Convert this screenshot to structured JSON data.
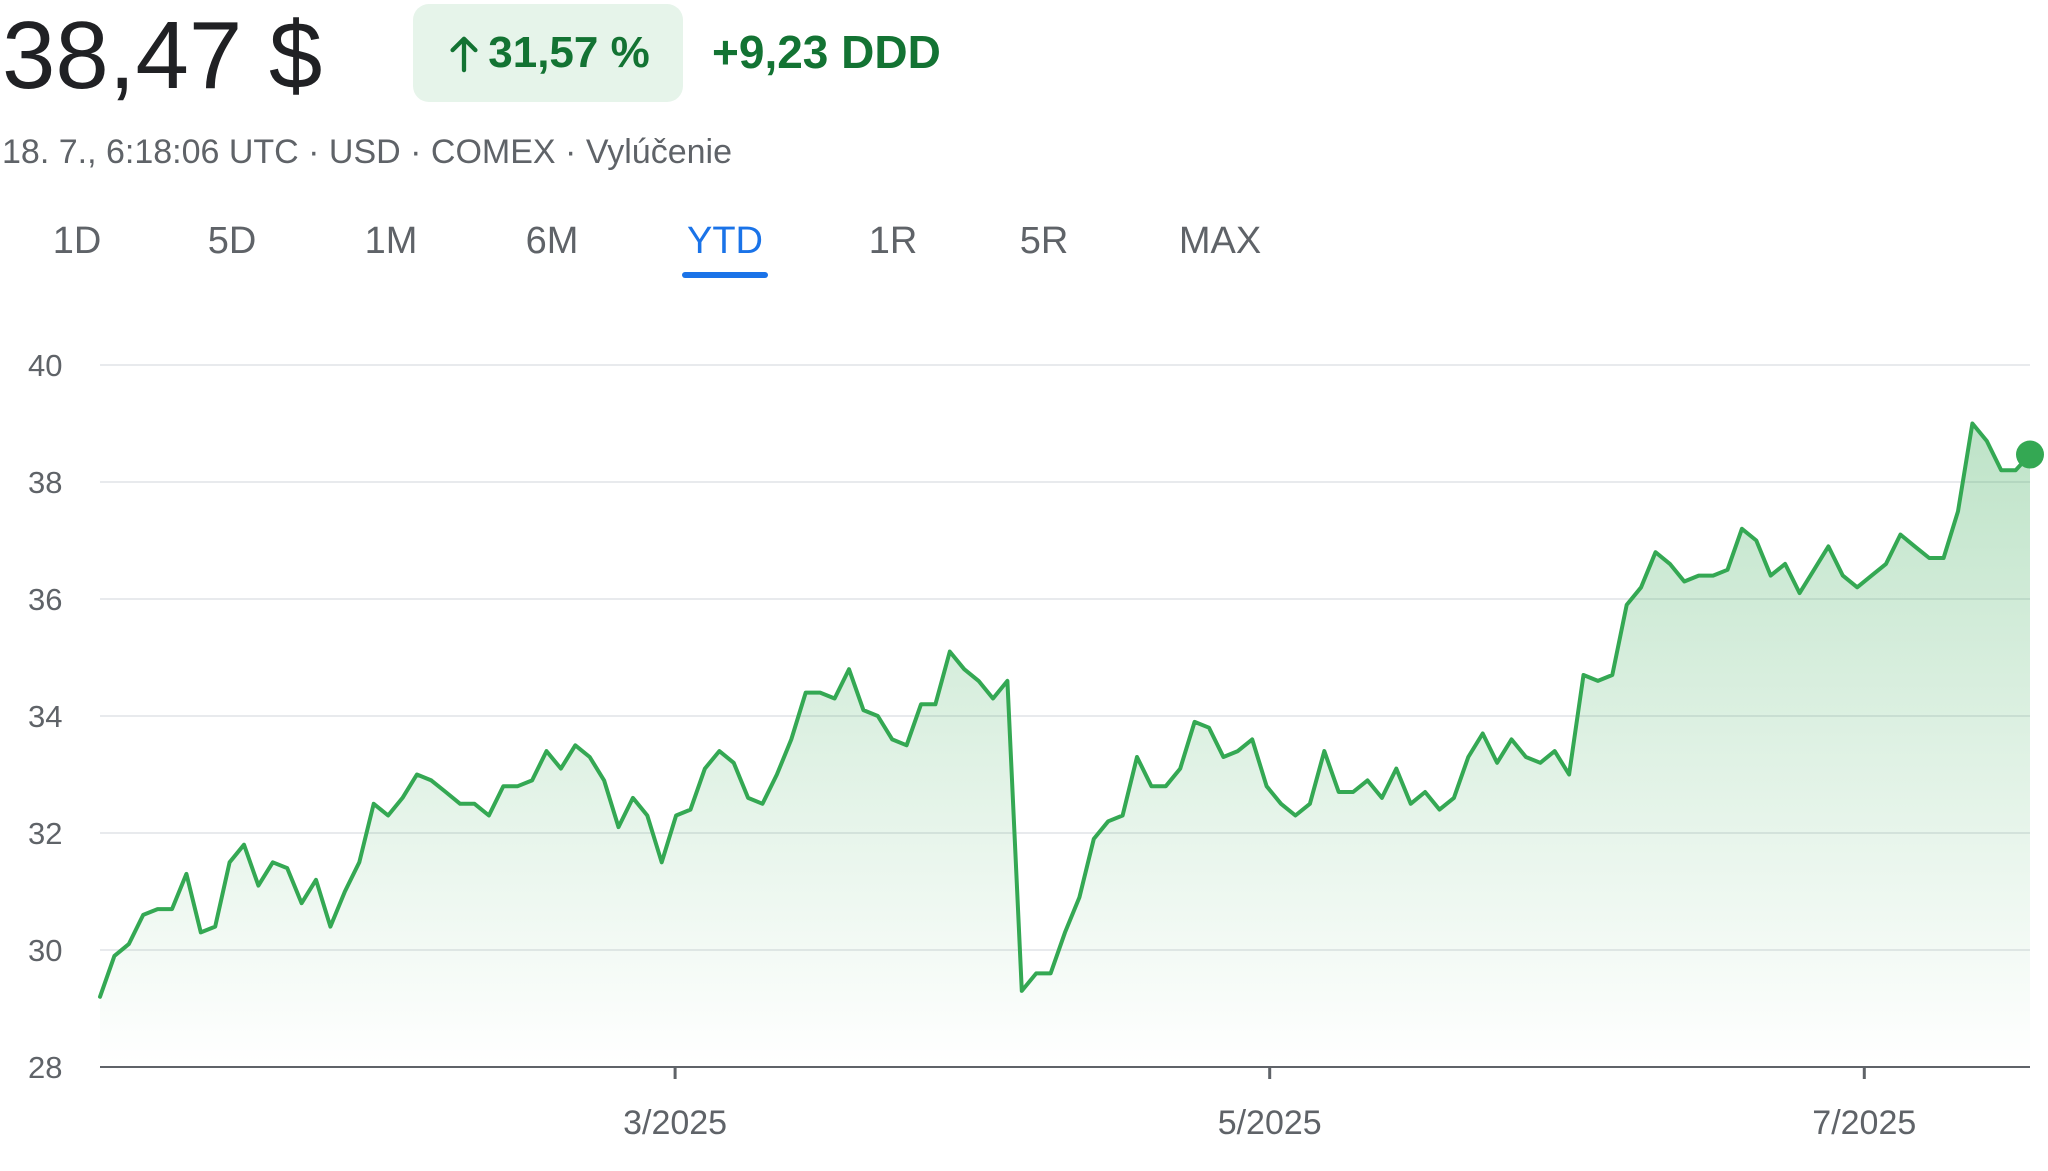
{
  "header": {
    "price": "38,47 $",
    "change_percent": "31,57 %",
    "change_abs": "+9,23 DDD",
    "meta": "18. 7., 6:18:06 UTC · USD · COMEX · Vylúčenie"
  },
  "tabs": [
    {
      "label": "1D"
    },
    {
      "label": "5D"
    },
    {
      "label": "1M"
    },
    {
      "label": "6M"
    },
    {
      "label": "YTD",
      "active": true
    },
    {
      "label": "1R"
    },
    {
      "label": "5R"
    },
    {
      "label": "MAX"
    }
  ],
  "colors": {
    "line": "#34a853",
    "positive": "#137333",
    "badge_bg": "#e6f4ea",
    "accent": "#1a73e8",
    "grid": "#e8eaed"
  },
  "icons": {
    "trend": "arrow-up-icon"
  },
  "chart_data": {
    "type": "area",
    "ylim": [
      28,
      40
    ],
    "yticks": [
      "28",
      "30",
      "32",
      "34",
      "36",
      "38",
      "40"
    ],
    "xlim": [
      "2025-01-01",
      "2025-07-18"
    ],
    "xticks": [
      {
        "label": "3/2025",
        "date": "2025-03-01"
      },
      {
        "label": "5/2025",
        "date": "2025-05-01"
      },
      {
        "label": "7/2025",
        "date": "2025-07-01"
      }
    ],
    "x": [
      "2025-01-01",
      "2025-01-03",
      "2025-01-04",
      "2025-01-06",
      "2025-01-07",
      "2025-01-09",
      "2025-01-10",
      "2025-01-12",
      "2025-01-13",
      "2025-01-15",
      "2025-01-16",
      "2025-01-18",
      "2025-01-20",
      "2025-01-21",
      "2025-01-23",
      "2025-01-25",
      "2025-01-26",
      "2025-01-28",
      "2025-01-30",
      "2025-02-01",
      "2025-02-02",
      "2025-02-04",
      "2025-02-06",
      "2025-02-08",
      "2025-02-09",
      "2025-02-11",
      "2025-02-13",
      "2025-02-15",
      "2025-02-16",
      "2025-02-18",
      "2025-02-20",
      "2025-02-22",
      "2025-02-23",
      "2025-02-25",
      "2025-02-27",
      "2025-03-01",
      "2025-03-02",
      "2025-03-04",
      "2025-03-06",
      "2025-03-08",
      "2025-03-09",
      "2025-03-11",
      "2025-03-13",
      "2025-03-15",
      "2025-03-16",
      "2025-03-18",
      "2025-03-20",
      "2025-03-22",
      "2025-03-23",
      "2025-03-25",
      "2025-03-27",
      "2025-03-29",
      "2025-03-30",
      "2025-04-01",
      "2025-04-03",
      "2025-04-05",
      "2025-04-06",
      "2025-04-08",
      "2025-04-09",
      "2025-04-11",
      "2025-04-13",
      "2025-04-15",
      "2025-04-16",
      "2025-04-18",
      "2025-04-20",
      "2025-04-22",
      "2025-04-23",
      "2025-04-25",
      "2025-04-27",
      "2025-04-29",
      "2025-05-01",
      "2025-05-03",
      "2025-05-05",
      "2025-05-06",
      "2025-05-08",
      "2025-05-10",
      "2025-05-12",
      "2025-05-13",
      "2025-05-15",
      "2025-05-17",
      "2025-05-19",
      "2025-05-20",
      "2025-05-22",
      "2025-05-24",
      "2025-05-26",
      "2025-05-27",
      "2025-05-29",
      "2025-05-31",
      "2025-06-02",
      "2025-06-03",
      "2025-06-05",
      "2025-06-07",
      "2025-06-09",
      "2025-06-10",
      "2025-06-12",
      "2025-06-14",
      "2025-06-16",
      "2025-06-17",
      "2025-06-19",
      "2025-06-21",
      "2025-06-23",
      "2025-06-24",
      "2025-06-26",
      "2025-06-28",
      "2025-06-30",
      "2025-07-01",
      "2025-07-03",
      "2025-07-05",
      "2025-07-07",
      "2025-07-08",
      "2025-07-10",
      "2025-07-12",
      "2025-07-14",
      "2025-07-16",
      "2025-07-18"
    ],
    "series": [
      {
        "values": [
          29.2,
          29.9,
          30.1,
          30.6,
          30.7,
          30.7,
          31.3,
          30.3,
          30.4,
          31.5,
          31.8,
          31.1,
          31.5,
          31.4,
          30.8,
          31.2,
          30.4,
          31.0,
          31.5,
          32.5,
          32.3,
          32.6,
          33.0,
          32.9,
          32.7,
          32.5,
          32.5,
          32.3,
          32.8,
          32.8,
          32.9,
          33.4,
          33.1,
          33.5,
          33.3,
          32.9,
          32.1,
          32.6,
          32.3,
          31.5,
          32.3,
          32.4,
          33.1,
          33.4,
          33.2,
          32.6,
          32.5,
          33.0,
          33.6,
          34.4,
          34.4,
          34.3,
          34.8,
          34.1,
          34.0,
          33.6,
          33.5,
          34.2,
          34.2,
          35.1,
          34.8,
          34.6,
          34.3,
          34.6,
          29.3,
          29.6,
          29.6,
          30.3,
          30.9,
          31.9,
          32.2,
          32.3,
          33.3,
          32.8,
          32.8,
          33.1,
          33.9,
          33.8,
          33.3,
          33.4,
          33.6,
          32.8,
          32.5,
          32.3,
          32.5,
          33.4,
          32.7,
          32.7,
          32.9,
          32.6,
          33.1,
          32.5,
          32.7,
          32.4,
          32.6,
          33.3,
          33.7,
          33.2,
          33.6,
          33.3,
          33.2,
          33.4,
          33.0,
          34.7,
          34.6,
          34.7,
          35.9,
          36.2,
          36.8,
          36.6,
          36.3,
          36.4,
          36.4,
          36.5,
          37.2,
          37.0,
          36.4,
          36.6,
          36.1,
          36.5,
          36.9,
          36.4,
          36.2,
          36.4,
          36.6,
          37.1,
          36.9,
          36.7,
          36.7,
          37.5,
          39.0,
          38.7,
          38.2,
          38.2,
          38.47
        ]
      }
    ],
    "last_value": 38.47
  }
}
